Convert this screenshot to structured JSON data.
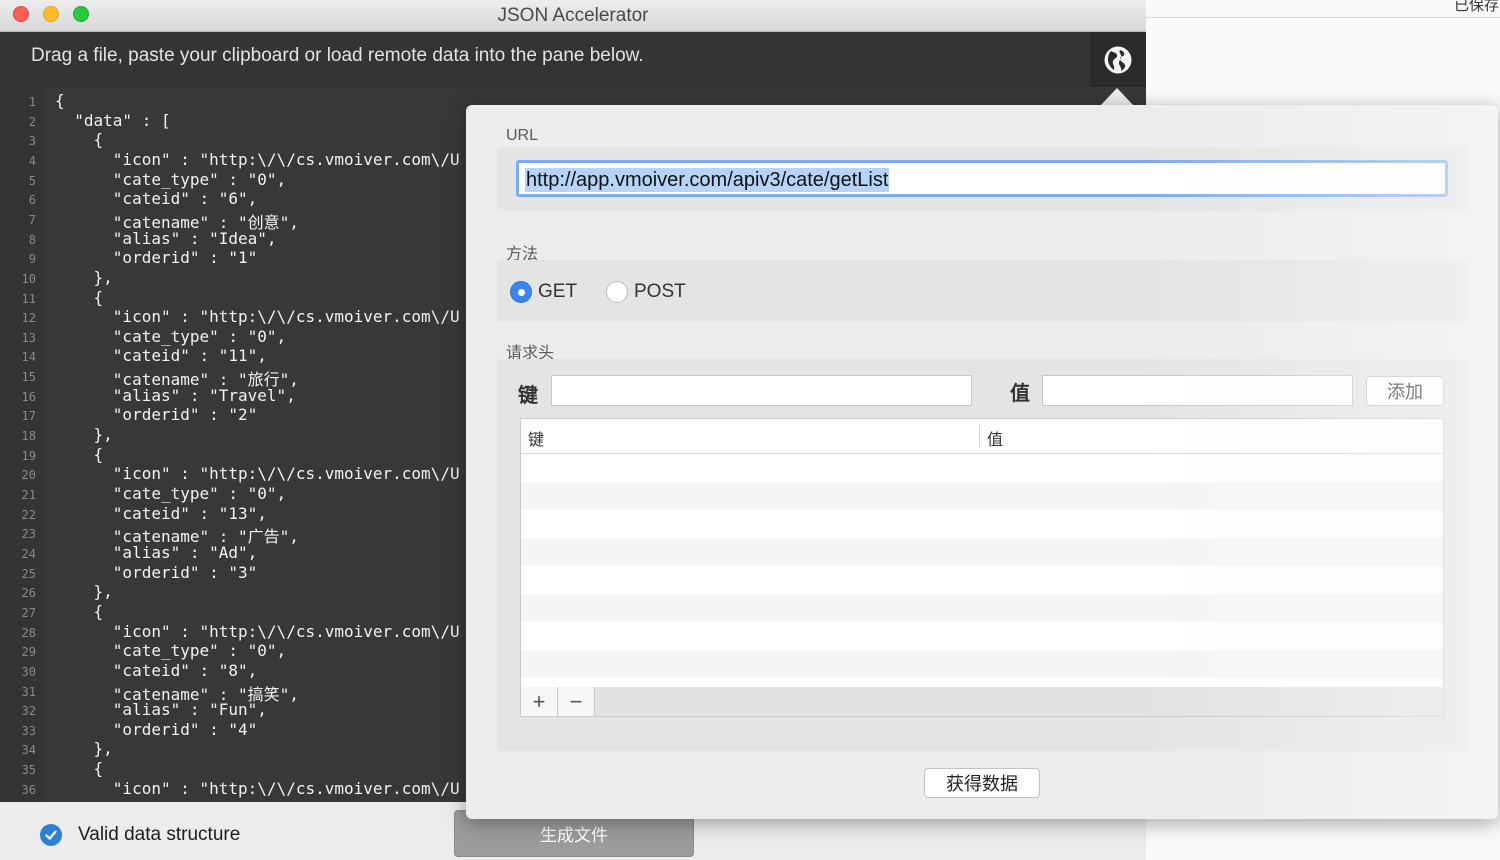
{
  "background_window": {
    "saved_text": "已保存"
  },
  "window": {
    "title": "JSON Accelerator"
  },
  "instruction_bar": {
    "text": "Drag a file, paste your clipboard or load remote data into the pane below."
  },
  "editor": {
    "lines": [
      {
        "n": "1",
        "text": "{"
      },
      {
        "n": "2",
        "text": "  \"data\" : ["
      },
      {
        "n": "3",
        "text": "    {"
      },
      {
        "n": "4",
        "text": "      \"icon\" : \"http:\\/\\/cs.vmoiver.com\\/U"
      },
      {
        "n": "5",
        "text": "      \"cate_type\" : \"0\","
      },
      {
        "n": "6",
        "text": "      \"cateid\" : \"6\","
      },
      {
        "n": "7",
        "text": "      \"catename\" : \"创意\","
      },
      {
        "n": "8",
        "text": "      \"alias\" : \"Idea\","
      },
      {
        "n": "9",
        "text": "      \"orderid\" : \"1\""
      },
      {
        "n": "10",
        "text": "    },"
      },
      {
        "n": "11",
        "text": "    {"
      },
      {
        "n": "12",
        "text": "      \"icon\" : \"http:\\/\\/cs.vmoiver.com\\/U"
      },
      {
        "n": "13",
        "text": "      \"cate_type\" : \"0\","
      },
      {
        "n": "14",
        "text": "      \"cateid\" : \"11\","
      },
      {
        "n": "15",
        "text": "      \"catename\" : \"旅行\","
      },
      {
        "n": "16",
        "text": "      \"alias\" : \"Travel\","
      },
      {
        "n": "17",
        "text": "      \"orderid\" : \"2\""
      },
      {
        "n": "18",
        "text": "    },"
      },
      {
        "n": "19",
        "text": "    {"
      },
      {
        "n": "20",
        "text": "      \"icon\" : \"http:\\/\\/cs.vmoiver.com\\/U"
      },
      {
        "n": "21",
        "text": "      \"cate_type\" : \"0\","
      },
      {
        "n": "22",
        "text": "      \"cateid\" : \"13\","
      },
      {
        "n": "23",
        "text": "      \"catename\" : \"广告\","
      },
      {
        "n": "24",
        "text": "      \"alias\" : \"Ad\","
      },
      {
        "n": "25",
        "text": "      \"orderid\" : \"3\""
      },
      {
        "n": "26",
        "text": "    },"
      },
      {
        "n": "27",
        "text": "    {"
      },
      {
        "n": "28",
        "text": "      \"icon\" : \"http:\\/\\/cs.vmoiver.com\\/U"
      },
      {
        "n": "29",
        "text": "      \"cate_type\" : \"0\","
      },
      {
        "n": "30",
        "text": "      \"cateid\" : \"8\","
      },
      {
        "n": "31",
        "text": "      \"catename\" : \"搞笑\","
      },
      {
        "n": "32",
        "text": "      \"alias\" : \"Fun\","
      },
      {
        "n": "33",
        "text": "      \"orderid\" : \"4\""
      },
      {
        "n": "34",
        "text": "    },"
      },
      {
        "n": "35",
        "text": "    {"
      },
      {
        "n": "36",
        "text": "      \"icon\" : \"http:\\/\\/cs.vmoiver.com\\/U"
      }
    ]
  },
  "status": {
    "text": "Valid data structure",
    "generate_label": "生成文件"
  },
  "popover": {
    "url_label": "URL",
    "url_value": "http://app.vmoiver.com/apiv3/cate/getList",
    "method_label": "方法",
    "method_options": [
      "GET",
      "POST"
    ],
    "method_selected": "GET",
    "headers_label": "请求头",
    "key_label": "键",
    "value_label": "值",
    "add_label": "添加",
    "table_headers": [
      "键",
      "值"
    ],
    "add_row_symbol": "+",
    "remove_row_symbol": "−",
    "fetch_label": "获得数据"
  },
  "colors": {
    "accent": "#3a86ee",
    "selection": "#b6d4fb",
    "check": "#2f7fd4"
  }
}
